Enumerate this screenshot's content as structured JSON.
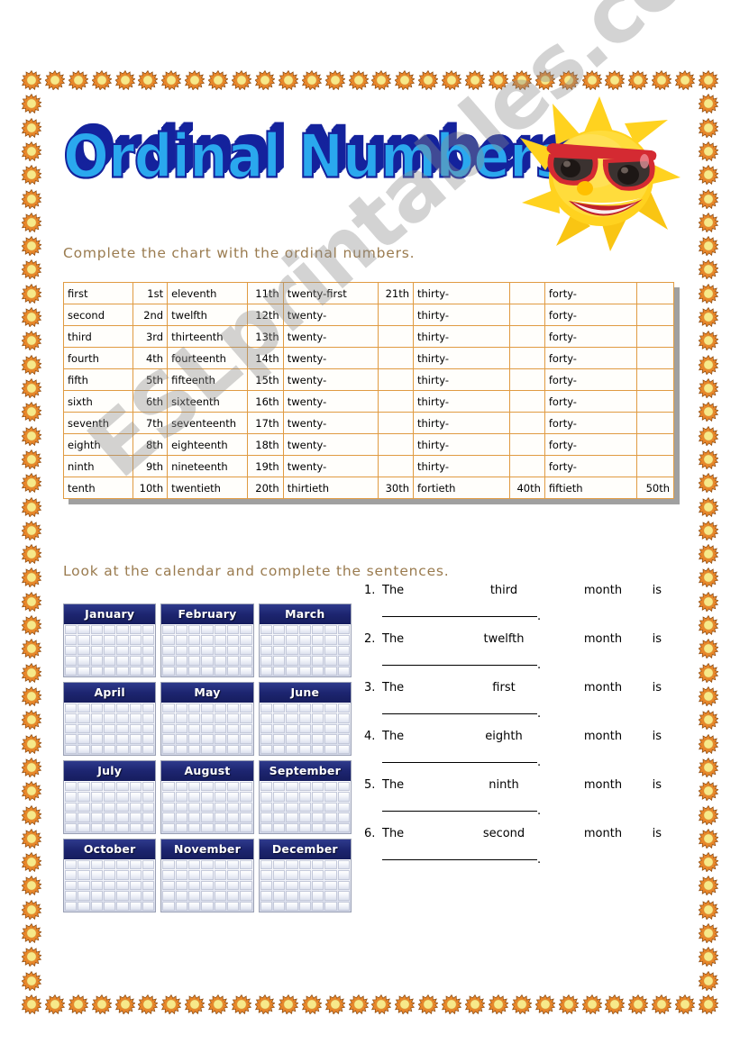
{
  "worksheet": {
    "title": "Ordinal Numbers",
    "watermark": "ESLprintables.com"
  },
  "instructions": {
    "chart": "Complete the chart with the ordinal numbers.",
    "calendar": "Look at the calendar and complete the sentences."
  },
  "ordinal_table": {
    "rows": [
      [
        "first",
        "1st",
        "eleventh",
        "11th",
        "twenty-first",
        "21th",
        "thirty-",
        "",
        "forty-",
        ""
      ],
      [
        "second",
        "2nd",
        "twelfth",
        "12th",
        "twenty-",
        "",
        "thirty-",
        "",
        "forty-",
        ""
      ],
      [
        "third",
        "3rd",
        "thirteenth",
        "13th",
        "twenty-",
        "",
        "thirty-",
        "",
        "forty-",
        ""
      ],
      [
        "fourth",
        "4th",
        "fourteenth",
        "14th",
        "twenty-",
        "",
        "thirty-",
        "",
        "forty-",
        ""
      ],
      [
        "fifth",
        "5th",
        "fifteenth",
        "15th",
        "twenty-",
        "",
        "thirty-",
        "",
        "forty-",
        ""
      ],
      [
        "sixth",
        "6th",
        "sixteenth",
        "16th",
        "twenty-",
        "",
        "thirty-",
        "",
        "forty-",
        ""
      ],
      [
        "seventh",
        "7th",
        "seventeenth",
        "17th",
        "twenty-",
        "",
        "thirty-",
        "",
        "forty-",
        ""
      ],
      [
        "eighth",
        "8th",
        "eighteenth",
        "18th",
        "twenty-",
        "",
        "thirty-",
        "",
        "forty-",
        ""
      ],
      [
        "ninth",
        "9th",
        "nineteenth",
        "19th",
        "twenty-",
        "",
        "thirty-",
        "",
        "forty-",
        ""
      ],
      [
        "tenth",
        "10th",
        "twentieth",
        "20th",
        "thirtieth",
        "30th",
        "fortieth",
        "40th",
        "fiftieth",
        "50th"
      ]
    ]
  },
  "calendar": {
    "months": [
      "January",
      "February",
      "March",
      "April",
      "May",
      "June",
      "July",
      "August",
      "September",
      "October",
      "November",
      "December"
    ]
  },
  "sentences": [
    {
      "number": "1.",
      "the": "The",
      "ordinal": "third",
      "month": "month",
      "is": "is",
      "period": "."
    },
    {
      "number": "2.",
      "the": "The",
      "ordinal": "twelfth",
      "month": "month",
      "is": "is",
      "period": "."
    },
    {
      "number": "3.",
      "the": "The",
      "ordinal": "first",
      "month": "month",
      "is": "is",
      "period": "."
    },
    {
      "number": "4.",
      "the": "The",
      "ordinal": "eighth",
      "month": "month",
      "is": "is",
      "period": "."
    },
    {
      "number": "5.",
      "the": "The",
      "ordinal": "ninth",
      "month": "month",
      "is": "is",
      "period": "."
    },
    {
      "number": "6.",
      "the": "The",
      "ordinal": "second",
      "month": "month",
      "is": "is",
      "period": "."
    }
  ],
  "colors": {
    "title_fill": "#2aa8ee",
    "title_shadow": "#14229c",
    "instruction_text": "#9a7b4f",
    "table_border": "#e09b42",
    "calendar_header": "#1d2570",
    "sun_body": "#e8862a",
    "sun_center": "#f7e98a"
  }
}
